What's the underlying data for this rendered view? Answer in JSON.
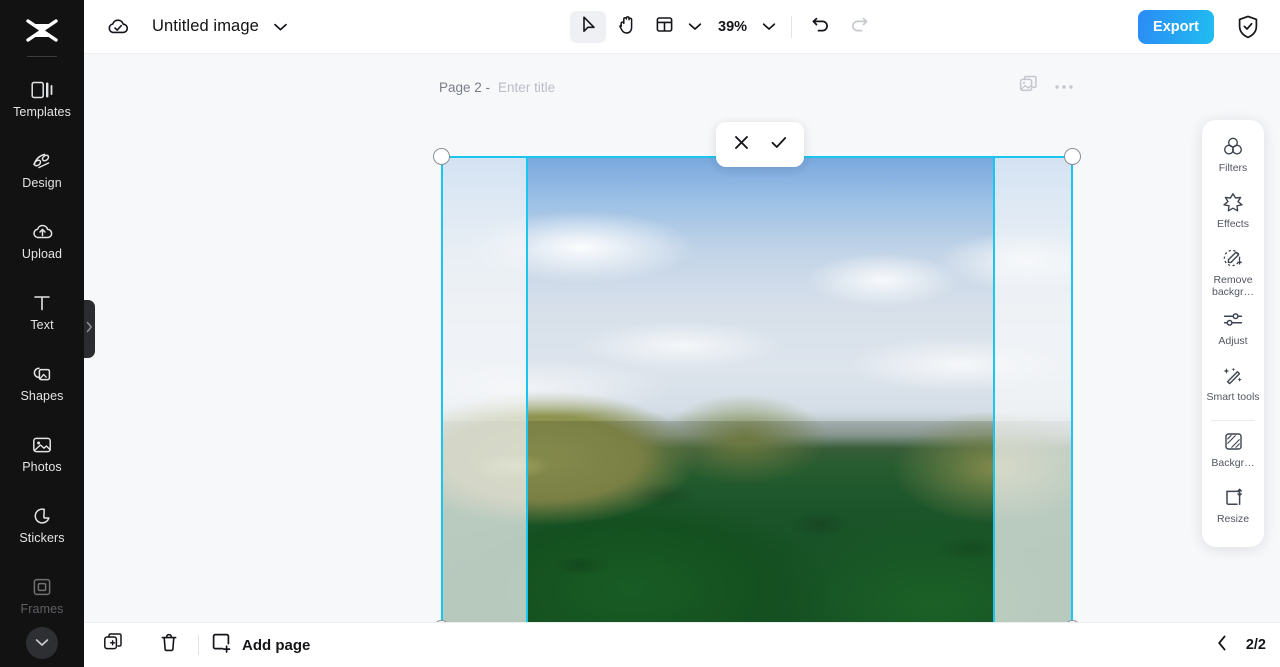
{
  "app": {
    "brand_icon": "capcut-logo-icon",
    "accent_start": "#2b8bf5",
    "accent_end": "#21bdf0",
    "selection_color": "#19c6f0"
  },
  "sidebar": {
    "items": [
      {
        "label": "Templates",
        "icon": "templates-icon",
        "dim": false
      },
      {
        "label": "Design",
        "icon": "design-icon",
        "dim": false
      },
      {
        "label": "Upload",
        "icon": "upload-cloud-icon",
        "dim": false
      },
      {
        "label": "Text",
        "icon": "text-icon",
        "dim": false
      },
      {
        "label": "Shapes",
        "icon": "shapes-icon",
        "dim": false
      },
      {
        "label": "Photos",
        "icon": "photos-icon",
        "dim": false
      },
      {
        "label": "Stickers",
        "icon": "stickers-icon",
        "dim": false
      },
      {
        "label": "Frames",
        "icon": "frames-icon",
        "dim": true
      }
    ],
    "more_icon": "chevron-down-icon",
    "expand_icon": "chevron-right-icon"
  },
  "topbar": {
    "cloud_icon": "cloud-saved-icon",
    "title": "Untitled image",
    "title_chevron_icon": "chevron-down-icon",
    "tools": [
      {
        "name": "select-tool",
        "icon": "cursor-arrow-icon",
        "active": true
      },
      {
        "name": "hand-tool",
        "icon": "hand-icon",
        "active": false
      },
      {
        "name": "layout-tool",
        "icon": "layout-grid-icon",
        "active": false
      }
    ],
    "layout_chevron_icon": "chevron-down-icon",
    "zoom_level": "39%",
    "zoom_chevron_icon": "chevron-down-icon",
    "undo_icon": "undo-arrow-icon",
    "redo_icon": "redo-arrow-icon",
    "undo_enabled": true,
    "redo_enabled": false,
    "export_label": "Export",
    "shield_icon": "shield-check-icon"
  },
  "canvas": {
    "page_number": "Page 2 -",
    "title_placeholder": "Enter title",
    "title_value": "",
    "duplicate_icon": "duplicate-image-icon",
    "more_icon": "more-horizontal-icon",
    "crop": {
      "cancel_icon": "close-x-icon",
      "confirm_icon": "check-icon"
    },
    "image_alt": "chocolate-hills-landscape-photo"
  },
  "right_panel": {
    "group_one": [
      {
        "label": "Filters",
        "icon": "filters-circles-icon"
      },
      {
        "label": "Effects",
        "icon": "effects-star-icon"
      },
      {
        "label": "Remove backgr…",
        "icon": "remove-background-icon"
      },
      {
        "label": "Adjust",
        "icon": "adjust-sliders-icon"
      },
      {
        "label": "Smart tools",
        "icon": "smart-tools-wand-icon"
      }
    ],
    "group_two": [
      {
        "label": "Backgr…",
        "icon": "background-swatch-icon"
      },
      {
        "label": "Resize",
        "icon": "resize-icon"
      }
    ]
  },
  "bottombar": {
    "duplicate_page_icon": "duplicate-page-icon",
    "delete_page_icon": "trash-icon",
    "add_page_icon": "add-page-icon",
    "add_page_label": "Add page",
    "prev_page_icon": "chevron-left-icon",
    "page_counter": "2/2"
  }
}
